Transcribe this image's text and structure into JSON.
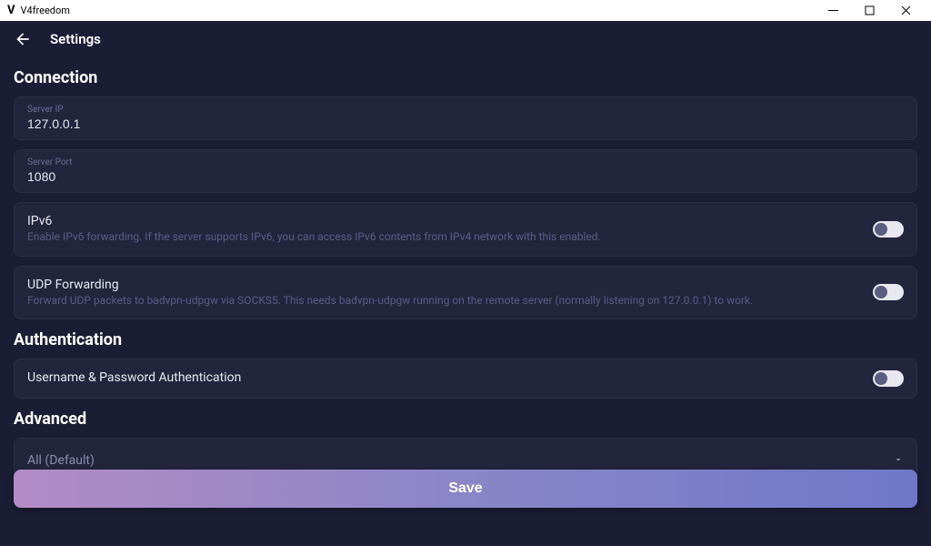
{
  "window": {
    "app_name": "V4freedom"
  },
  "header": {
    "title": "Settings"
  },
  "sections": {
    "connection": {
      "title": "Connection",
      "server_ip": {
        "label": "Server IP",
        "value": "127.0.0.1"
      },
      "server_port": {
        "label": "Server Port",
        "value": "1080"
      },
      "ipv6": {
        "title": "IPv6",
        "desc": "Enable IPv6 forwarding. If the server supports IPv6, you can access IPv6 contents from IPv4 network with this enabled."
      },
      "udp": {
        "title": "UDP Forwarding",
        "desc": "Forward UDP packets to badvpn-udpgw via SOCKS5. This needs badvpn-udpgw running on the remote server (normally listening on 127.0.0.1) to work."
      }
    },
    "authentication": {
      "title": "Authentication",
      "userpass": {
        "title": "Username & Password Authentication"
      }
    },
    "advanced": {
      "title": "Advanced",
      "selected": "All (Default)"
    }
  },
  "actions": {
    "save": "Save"
  }
}
